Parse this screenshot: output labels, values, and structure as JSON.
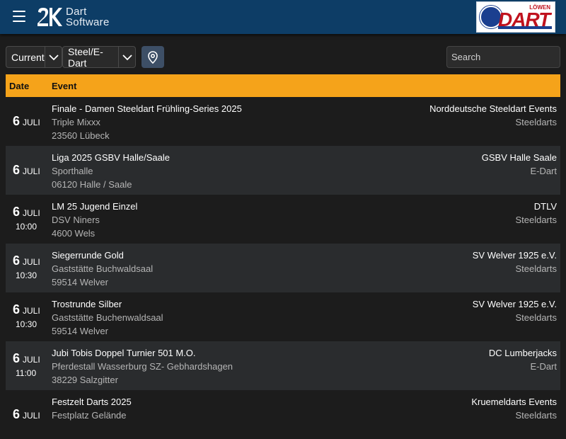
{
  "header": {
    "logo_line1": "Dart",
    "logo_line2": "Software",
    "partner_logo_top": "LÖWEN",
    "partner_logo_main": "DART",
    "bar_color": "#0d3d66"
  },
  "filters": {
    "period": "Current",
    "category": "Steel/E-Dart",
    "search_placeholder": "Search",
    "search_value": ""
  },
  "table": {
    "col_date": "Date",
    "col_event": "Event",
    "header_color": "#f5a31a"
  },
  "events": [
    {
      "day": "6",
      "month": "JULI",
      "time": "",
      "title": "Finale - Damen Steeldart Frühling-Series 2025",
      "venue": "Triple Mixxx",
      "city": "23560 Lübeck",
      "organizer": "Norddeutsche Steeldart Events",
      "type": "Steeldarts"
    },
    {
      "day": "6",
      "month": "JULI",
      "time": "",
      "title": "Liga 2025 GSBV Halle/Saale",
      "venue": "Sporthalle",
      "city": "06120 Halle / Saale",
      "organizer": "GSBV Halle Saale",
      "type": "E-Dart"
    },
    {
      "day": "6",
      "month": "JULI",
      "time": "10:00",
      "title": "LM 25 Jugend Einzel",
      "venue": "DSV Niners",
      "city": "4600 Wels",
      "organizer": "DTLV",
      "type": "Steeldarts"
    },
    {
      "day": "6",
      "month": "JULI",
      "time": "10:30",
      "title": "Siegerrunde Gold",
      "venue": "Gaststätte Buchwaldsaal",
      "city": "59514 Welver",
      "organizer": "SV Welver 1925 e.V.",
      "type": "Steeldarts"
    },
    {
      "day": "6",
      "month": "JULI",
      "time": "10:30",
      "title": "Trostrunde Silber",
      "venue": "Gaststätte Buchenwaldsaal",
      "city": "59514 Welver",
      "organizer": "SV Welver 1925 e.V.",
      "type": "Steeldarts"
    },
    {
      "day": "6",
      "month": "JULI",
      "time": "11:00",
      "title": "Jubi Tobis Doppel Turnier 501 M.O.",
      "venue": "Pferdestall Wasserburg SZ- Gebhardshagen",
      "city": "38229 Salzgitter",
      "organizer": "DC Lumberjacks",
      "type": "E-Dart"
    },
    {
      "day": "6",
      "month": "JULI",
      "time": "",
      "title": "Festzelt Darts 2025",
      "venue": "Festplatz Gelände",
      "city": "",
      "organizer": "Kruemeldarts Events",
      "type": "Steeldarts"
    }
  ]
}
